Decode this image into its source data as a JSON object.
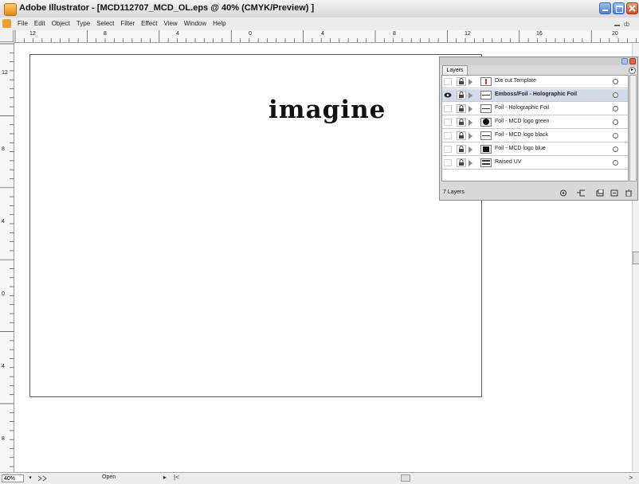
{
  "window": {
    "title": "Adobe Illustrator - [MCD112707_MCD_OL.eps @ 40% (CMYK/Preview) ]",
    "title_text_color": "#111111"
  },
  "menu": {
    "items": [
      "File",
      "Edit",
      "Object",
      "Type",
      "Select",
      "Filter",
      "Effect",
      "View",
      "Window",
      "Help"
    ],
    "doc_restore_glyph": "ȸ"
  },
  "rulers": {
    "horizontal_labels": [
      "12",
      "8",
      "4",
      "0",
      "4",
      "8",
      "12",
      "16",
      "20"
    ],
    "vertical_labels": [
      "12",
      "8",
      "4",
      "0",
      "4",
      "8"
    ]
  },
  "artboard": {
    "text": "imagine"
  },
  "layers_panel": {
    "tab_label": "Layers",
    "menu_glyph": "▸",
    "layers": [
      {
        "name": "Die cut Template",
        "thumb": "template",
        "visible": false,
        "selected": false
      },
      {
        "name": "Emboss/Foil - Holographic Foil",
        "thumb": "line",
        "visible": true,
        "selected": true
      },
      {
        "name": "Foil - Holographic Foil",
        "thumb": "line",
        "visible": false,
        "selected": false
      },
      {
        "name": "Foil - MCD logo green",
        "thumb": "circle",
        "visible": false,
        "selected": false
      },
      {
        "name": "Foil - MCD logo black",
        "thumb": "line",
        "visible": false,
        "selected": false
      },
      {
        "name": "Foil - MCD logo blue",
        "thumb": "solid",
        "visible": false,
        "selected": false
      },
      {
        "name": "Raised UV",
        "thumb": "bars",
        "visible": false,
        "selected": false
      }
    ],
    "count_label": "7 Layers"
  },
  "statusbar": {
    "zoom": "40%",
    "dropdown_glyph": "▾",
    "status_text": "Open",
    "arrow_glyph": "▸",
    "left_glyph": "|<",
    "right_glyph": ">"
  }
}
